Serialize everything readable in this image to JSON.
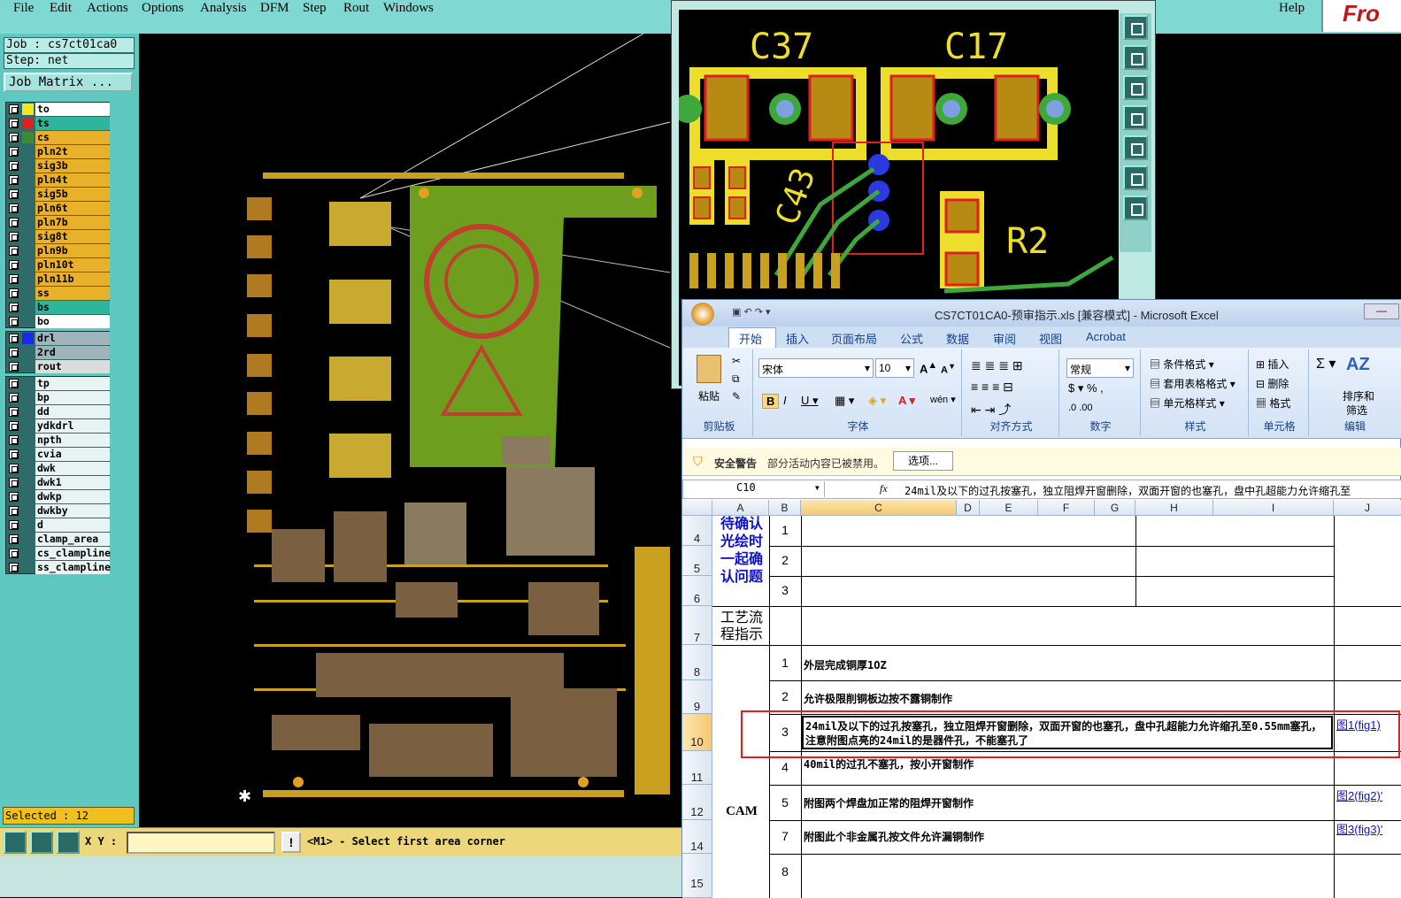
{
  "menubar": {
    "file": "File",
    "edit": "Edit",
    "actions": "Actions",
    "options": "Options",
    "analysis": "Analysis",
    "dfm": "DFM",
    "step": "Step",
    "rout": "Rout",
    "windows": "Windows",
    "help": "Help",
    "brand": "Fro"
  },
  "job": {
    "job_label": "Job : cs7ct01ca0",
    "step_label": "Step: net",
    "matrix_button": "Job Matrix ...",
    "selected": "Selected : 12"
  },
  "layers_group1": [
    {
      "name": "to",
      "color": "#f5e61b",
      "bg": "#ffffff"
    },
    {
      "name": "ts",
      "color": "#e02020",
      "bg": "#2fb59c"
    },
    {
      "name": "cs",
      "color": "#3a8c2c",
      "bg": "#e9b02b"
    },
    {
      "name": "pln2t",
      "color": "#2d6c68",
      "bg": "#e9b02b"
    },
    {
      "name": "sig3b",
      "color": "#2d6c68",
      "bg": "#e9b02b"
    },
    {
      "name": "pln4t",
      "color": "#2d6c68",
      "bg": "#e9b02b"
    },
    {
      "name": "sig5b",
      "color": "#2d6c68",
      "bg": "#e9b02b"
    },
    {
      "name": "pln6t",
      "color": "#2d6c68",
      "bg": "#e9b02b"
    },
    {
      "name": "pln7b",
      "color": "#2d6c68",
      "bg": "#e9b02b"
    },
    {
      "name": "sig8t",
      "color": "#2d6c68",
      "bg": "#e9b02b"
    },
    {
      "name": "pln9b",
      "color": "#2d6c68",
      "bg": "#e9b02b"
    },
    {
      "name": "pln10t",
      "color": "#2d6c68",
      "bg": "#e9b02b"
    },
    {
      "name": "pln11b",
      "color": "#2d6c68",
      "bg": "#e9b02b"
    },
    {
      "name": "ss",
      "color": "#2d6c68",
      "bg": "#e9b02b"
    },
    {
      "name": "bs",
      "color": "#2d6c68",
      "bg": "#2fb59c"
    },
    {
      "name": "bo",
      "color": "#2d6c68",
      "bg": "#ffffff"
    }
  ],
  "layers_group2": [
    {
      "name": "drl",
      "color": "#1a2ae0",
      "bg": "#9fb3bb"
    },
    {
      "name": "2rd",
      "color": "#2d6c68",
      "bg": "#9fb3bb"
    },
    {
      "name": "rout",
      "color": "#2d6c68",
      "bg": "#dcdcdc"
    }
  ],
  "layers_group3": [
    {
      "name": "tp"
    },
    {
      "name": "bp"
    },
    {
      "name": "dd"
    },
    {
      "name": "ydkdrl"
    },
    {
      "name": "npth"
    },
    {
      "name": "cvia"
    },
    {
      "name": "dwk"
    },
    {
      "name": "dwk1"
    },
    {
      "name": "dwkp"
    },
    {
      "name": "dwkby"
    },
    {
      "name": "d"
    },
    {
      "name": "clamp_area"
    },
    {
      "name": "cs_clampline"
    },
    {
      "name": "ss_clampline"
    }
  ],
  "bottom": {
    "xy_label": "X Y :",
    "xy_value": "",
    "prompt": "<M1> - Select first area corner"
  },
  "zoom": {
    "c37": "C37",
    "c17": "C17",
    "r2": "R2",
    "c43": "C43"
  },
  "excel": {
    "title": "CS7CT01CA0-预审指示.xls [兼容模式] - Microsoft Excel",
    "tabs": [
      "开始",
      "插入",
      "页面布局",
      "公式",
      "数据",
      "审阅",
      "视图",
      "Acrobat"
    ],
    "font_name": "宋体",
    "font_size": "10",
    "number_format": "常规",
    "groups": {
      "clipboard": "剪贴板",
      "font": "字体",
      "align": "对齐方式",
      "number": "数字",
      "styles": "样式",
      "cells": "单元格",
      "edit": "编辑"
    },
    "paste": "粘贴",
    "styles": [
      "条件格式",
      "套用表格格式",
      "单元格样式"
    ],
    "cells": [
      "插入",
      "删除",
      "格式"
    ],
    "edit": [
      "排序和",
      "筛选"
    ],
    "security": {
      "title": "安全警告",
      "message": "部分活动内容已被禁用。",
      "button": "选项..."
    },
    "namebox": "C10",
    "fx": "fx",
    "formula": "24mil及以下的过孔按塞孔，独立阻焊开窗删除，双面开窗的也塞孔，盘中孔超能力允许缩孔至",
    "columns": [
      "A",
      "B",
      "C",
      "D",
      "E",
      "F",
      "G",
      "H",
      "I",
      "J"
    ],
    "rows": {
      "r4": "4",
      "r5": "5",
      "r6": "6",
      "r7": "7",
      "r8": "8",
      "r9": "9",
      "r10": "10",
      "r11": "11",
      "r12": "12",
      "r14": "14",
      "r15": "15"
    },
    "a_confirm": "待确认光绘时一起确认问题",
    "a_process": "工艺流程指示",
    "a_cam": "CAM",
    "b": [
      "1",
      "2",
      "3",
      "1",
      "2",
      "3",
      "4",
      "5",
      "7",
      "8"
    ],
    "c8": "外层完成铜厚1OZ",
    "c9": "允许极限削铜板边按不露铜制作",
    "c10": "24mil及以下的过孔按塞孔，独立阻焊开窗删除，双面开窗的也塞孔，盘中孔超能力允许缩孔至0.55mm塞孔，注意附图点亮的24mil的是器件孔，不能塞孔了",
    "c11": "40mil的过孔不塞孔，按小开窗制作",
    "c12": "附图两个焊盘加正常的阻焊开窗制作",
    "c14": "附图此个非金属孔按文件允许漏铜制作",
    "j10": "图1(fig1)",
    "j12": "图2(fig2)'",
    "j14": "图3(fig3)'"
  }
}
